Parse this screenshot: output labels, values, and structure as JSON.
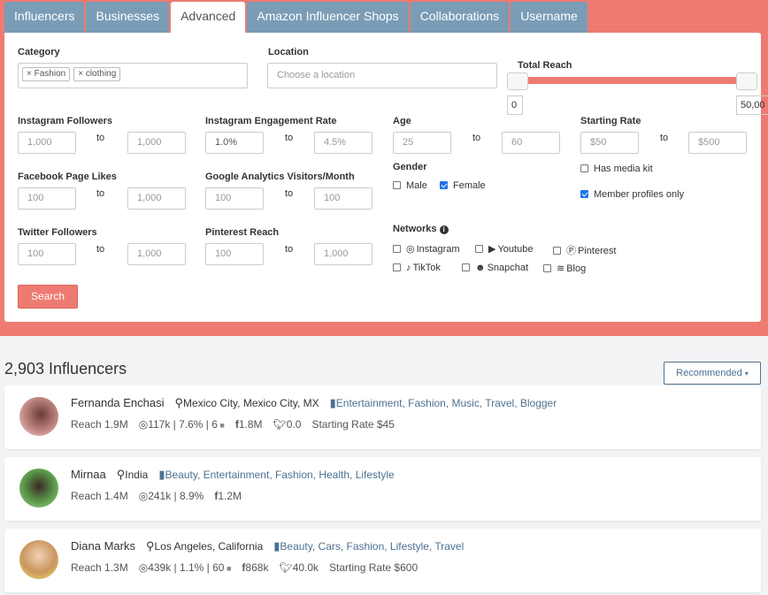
{
  "tabs": [
    "Influencers",
    "Businesses",
    "Advanced",
    "Amazon Influencer Shops",
    "Collaborations",
    "Username"
  ],
  "active_tab": "Advanced",
  "filters": {
    "category": {
      "label": "Category",
      "chips": [
        "Fashion",
        "clothing"
      ]
    },
    "location": {
      "label": "Location",
      "placeholder": "Choose a location"
    },
    "total_reach": {
      "label": "Total Reach",
      "min": "0",
      "max": "50,00"
    },
    "instagram_followers": {
      "label": "Instagram Followers",
      "from": "1,000",
      "to": "1,000"
    },
    "engagement": {
      "label": "Instagram Engagement Rate",
      "from": "1.0%",
      "to": "4.5%"
    },
    "age": {
      "label": "Age",
      "from": "25",
      "to": "60"
    },
    "starting_rate": {
      "label": "Starting Rate",
      "from": "$50",
      "to": "$500"
    },
    "facebook": {
      "label": "Facebook Page Likes",
      "from": "100",
      "to": "1,000"
    },
    "google": {
      "label": "Google Analytics Visitors/Month",
      "from": "100",
      "to": "100"
    },
    "twitter": {
      "label": "Twitter Followers",
      "from": "100",
      "to": "1,000"
    },
    "pinterest": {
      "label": "Pinterest Reach",
      "from": "100",
      "to": "1,000"
    },
    "to_label": "to",
    "gender": {
      "label": "Gender",
      "male": "Male",
      "female": "Female"
    },
    "has_media_kit": "Has media kit",
    "member_only": "Member profiles only",
    "networks": {
      "label": "Networks",
      "items": [
        "Instagram",
        "Youtube",
        "Pinterest",
        "TikTok",
        "Snapchat",
        "Blog"
      ]
    },
    "search": "Search"
  },
  "results": {
    "count": "2,903 Influencers",
    "sort": "Recommended"
  },
  "influencers": [
    {
      "name": "Fernanda Enchasi",
      "location": "Mexico City, Mexico City, MX",
      "tags": "Entertainment, Fashion, Music, Travel, Blogger",
      "reach": "Reach 1.9M",
      "ig": "117k | 7.6% | 6",
      "fb": "1.8M",
      "tw": "0.0",
      "rate": "Starting Rate $45"
    },
    {
      "name": "Mirnaa",
      "location": "India",
      "tags": "Beauty, Entertainment, Fashion, Health, Lifestyle",
      "reach": "Reach 1.4M",
      "ig": "241k | 8.9%",
      "fb": "1.2M"
    },
    {
      "name": "Diana Marks",
      "location": "Los Angeles, California",
      "tags": "Beauty, Cars, Fashion, Lifestyle, Travel",
      "reach": "Reach 1.3M",
      "ig": "439k | 1.1% | 60",
      "fb": "868k",
      "tw": "40.0k",
      "rate": "Starting Rate $600"
    }
  ]
}
